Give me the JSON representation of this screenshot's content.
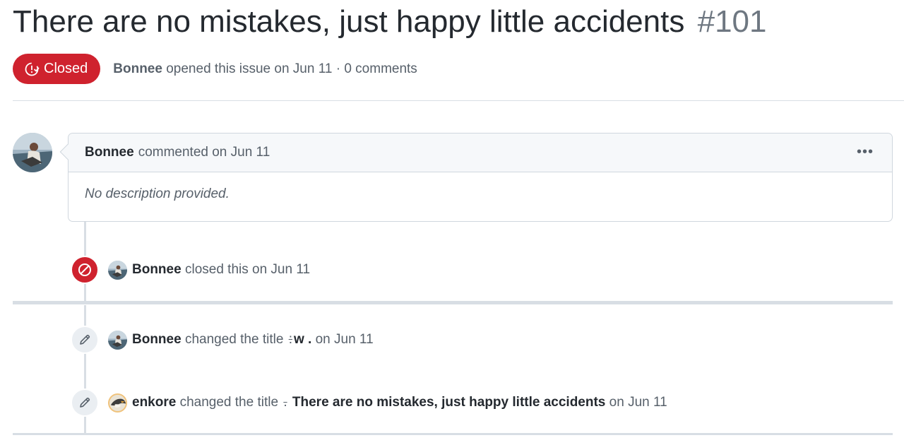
{
  "issue": {
    "title": "There are no mistakes, just happy little accidents",
    "number": "#101",
    "state": "Closed",
    "author": "Bonnee",
    "opened_text": "opened this issue on Jun 11 · 0 comments"
  },
  "comment": {
    "author": "Bonnee",
    "header_text": "commented on Jun 11",
    "menu_label": "•••",
    "body": "No description provided."
  },
  "timeline": [
    {
      "icon": "circle-slash-icon",
      "actor": "Bonnee",
      "text": "closed this on Jun 11"
    },
    {
      "icon": "pencil-icon",
      "actor": "Bonnee",
      "text_before": "changed the title",
      "old_title": ":",
      "new_title": "w .",
      "text_after": "on Jun 11"
    },
    {
      "icon": "pencil-icon",
      "actor": "enkore",
      "text_before": "changed the title",
      "old_title": ".",
      "new_title": "There are no mistakes, just happy little accidents",
      "text_after": "on Jun 11"
    }
  ],
  "colors": {
    "closed_red": "#cf222e",
    "muted_text": "#57606a",
    "border": "#d0d7de"
  }
}
